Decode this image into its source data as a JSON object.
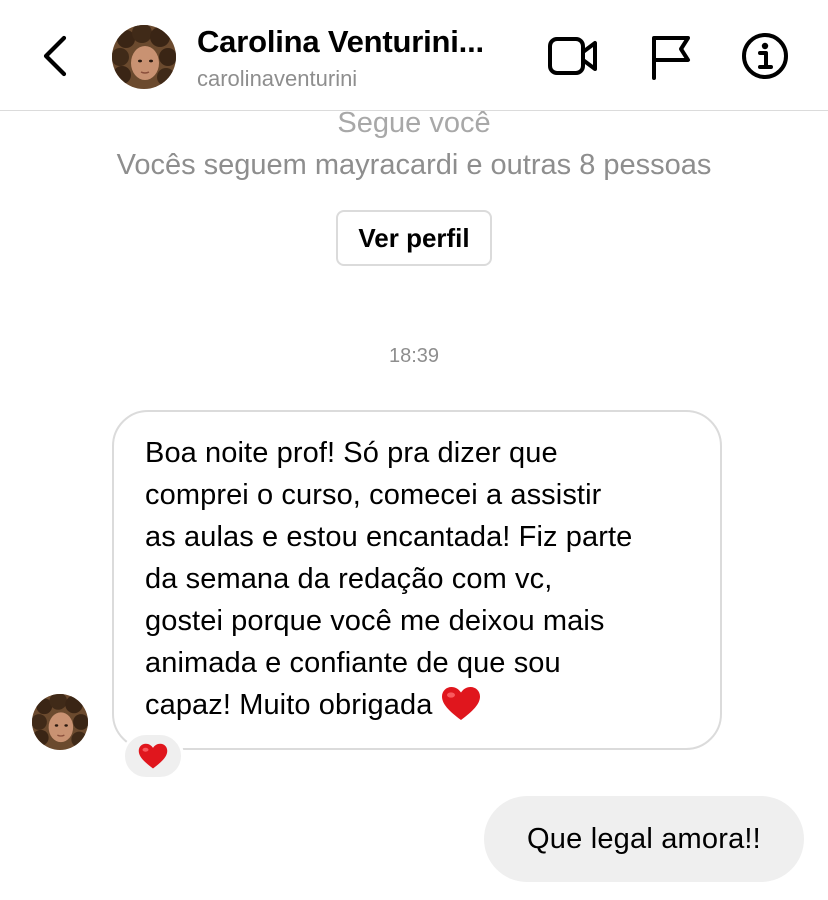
{
  "header": {
    "contact_name": "Carolina Venturini...",
    "username": "carolinaventurini",
    "icons": {
      "back": "chevron-left-icon",
      "video": "video-camera-icon",
      "flag": "flag-icon",
      "info": "info-icon"
    }
  },
  "profile_summary": {
    "follows_you": "Segue você",
    "mutuals": "Vocês seguem mayracardi e outras 8 pessoas",
    "view_profile_label": "Ver perfil"
  },
  "conversation": {
    "timestamp": "18:39",
    "received": {
      "text": "Boa noite prof! Só pra dizer que\ncomprei o curso, comecei a assistir\nas aulas e estou encantada! Fiz parte\nda semana da redação com vc,\ngostei porque você me deixou mais\nanimada e confiante de que sou\ncapaz! Muito obrigada",
      "inline_emoji": "red-heart-icon",
      "reaction": "red-heart-icon"
    },
    "sent": {
      "text": "Que legal amora!!"
    }
  },
  "colors": {
    "divider": "#dbdbdb",
    "secondary_text": "#8e8e8e",
    "bubble_gray": "#efefef",
    "heart_red": "#e0161d"
  }
}
